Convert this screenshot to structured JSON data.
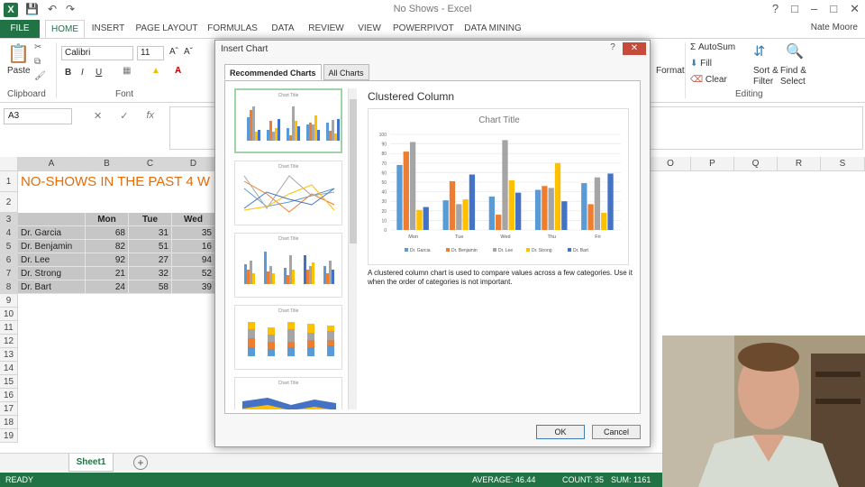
{
  "window": {
    "title": "No Shows - Excel",
    "user": "Nate Moore"
  },
  "tabs": [
    "FILE",
    "HOME",
    "INSERT",
    "PAGE LAYOUT",
    "FORMULAS",
    "DATA",
    "REVIEW",
    "VIEW",
    "POWERPIVOT",
    "DATA MINING"
  ],
  "ribbon": {
    "paste_label": "Paste",
    "clipboard_label": "Clipboard",
    "font_label": "Font",
    "font_name": "Calibri",
    "font_size": "11",
    "editing_label": "Editing",
    "format_label": "Format",
    "autosum_label": "AutoSum",
    "fill_label": "Fill",
    "clear_label": "Clear",
    "sort_label": "Sort &",
    "filter_label": "Filter",
    "find_label": "Find &",
    "select_label": "Select"
  },
  "formula_bar": {
    "name_box": "A3",
    "fx": "fx"
  },
  "sheet": {
    "columns": [
      "A",
      "B",
      "C",
      "D",
      "O",
      "P",
      "Q",
      "R",
      "S"
    ],
    "title": "NO-SHOWS IN THE PAST 4 W",
    "header": [
      "Mon",
      "Tue",
      "Wed"
    ],
    "rows": [
      {
        "name": "Dr. Garcia",
        "mon": "68",
        "tue": "31",
        "wed": "35"
      },
      {
        "name": "Dr. Benjamin",
        "mon": "82",
        "tue": "51",
        "wed": "16"
      },
      {
        "name": "Dr. Lee",
        "mon": "92",
        "tue": "27",
        "wed": "94"
      },
      {
        "name": "Dr. Strong",
        "mon": "21",
        "tue": "32",
        "wed": "52"
      },
      {
        "name": "Dr. Bart",
        "mon": "24",
        "tue": "58",
        "wed": "39"
      }
    ],
    "row_numbers": [
      "1",
      "2",
      "3",
      "4",
      "5",
      "6",
      "7",
      "8",
      "9",
      "10",
      "11",
      "12",
      "13",
      "14",
      "15",
      "16",
      "17",
      "18",
      "19"
    ],
    "sheet_tab": "Sheet1"
  },
  "status": {
    "ready": "READY",
    "average": "AVERAGE: 46.44",
    "count": "COUNT: 35",
    "sum": "SUM: 1161"
  },
  "dialog": {
    "title": "Insert Chart",
    "tab_recommended": "Recommended Charts",
    "tab_all": "All Charts",
    "preview_title": "Clustered Column",
    "description": "A clustered column chart is used to compare values across a few categories. Use it when the order of categories is not important.",
    "ok": "OK",
    "cancel": "Cancel",
    "thumb_title": "Chart Title"
  },
  "chart_data": {
    "type": "bar",
    "title": "Chart Title",
    "categories": [
      "Mon",
      "Tue",
      "Wed",
      "Thu",
      "Fri"
    ],
    "ylim": [
      0,
      100
    ],
    "yticks": [
      0,
      10,
      20,
      30,
      40,
      50,
      60,
      70,
      80,
      90,
      100
    ],
    "series": [
      {
        "name": "Dr. Garcia",
        "color": "#5b9bd5",
        "values": [
          68,
          31,
          35,
          42,
          49
        ]
      },
      {
        "name": "Dr. Benjamin",
        "color": "#ed7d31",
        "values": [
          82,
          51,
          16,
          46,
          27
        ]
      },
      {
        "name": "Dr. Lee",
        "color": "#a5a5a5",
        "values": [
          92,
          27,
          94,
          44,
          55
        ]
      },
      {
        "name": "Dr. Strong",
        "color": "#ffc000",
        "values": [
          21,
          32,
          52,
          70,
          18
        ]
      },
      {
        "name": "Dr. Bart",
        "color": "#4472c4",
        "values": [
          24,
          58,
          39,
          30,
          59
        ]
      }
    ],
    "legend": "bottom"
  }
}
